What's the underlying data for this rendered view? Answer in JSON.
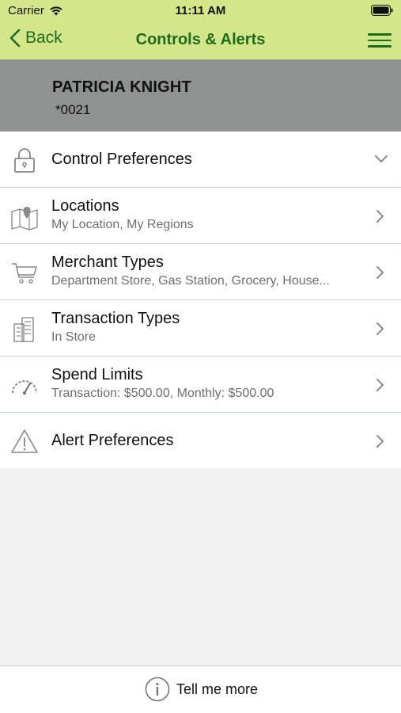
{
  "status_bar": {
    "carrier": "Carrier",
    "time": "11:11 AM"
  },
  "nav": {
    "back_label": "Back",
    "title": "Controls & Alerts"
  },
  "account": {
    "name": "PATRICIA KNIGHT",
    "number": "*0021"
  },
  "list": {
    "items": [
      {
        "title": "Control Preferences",
        "subtitle": "",
        "icon": "lock-icon",
        "indicator": "chevron-down"
      },
      {
        "title": "Locations",
        "subtitle": "My Location, My Regions",
        "icon": "map-pin-icon",
        "indicator": "chevron-right"
      },
      {
        "title": "Merchant Types",
        "subtitle": "Department Store, Gas Station, Grocery, House...",
        "icon": "shopping-cart-icon",
        "indicator": "chevron-right"
      },
      {
        "title": "Transaction Types",
        "subtitle": "In Store",
        "icon": "building-icon",
        "indicator": "chevron-right"
      },
      {
        "title": "Spend Limits",
        "subtitle": "Transaction: $500.00, Monthly: $500.00",
        "icon": "speedometer-icon",
        "indicator": "chevron-right"
      },
      {
        "title": "Alert Preferences",
        "subtitle": "",
        "icon": "warning-icon",
        "indicator": "chevron-right"
      }
    ]
  },
  "footer": {
    "tell_more_label": "Tell me more"
  },
  "colors": {
    "header_bg": "#d4e68a",
    "brand_green": "#1d6b1d",
    "banner_bg": "#8e9291",
    "page_bg": "#f2f2f2"
  }
}
